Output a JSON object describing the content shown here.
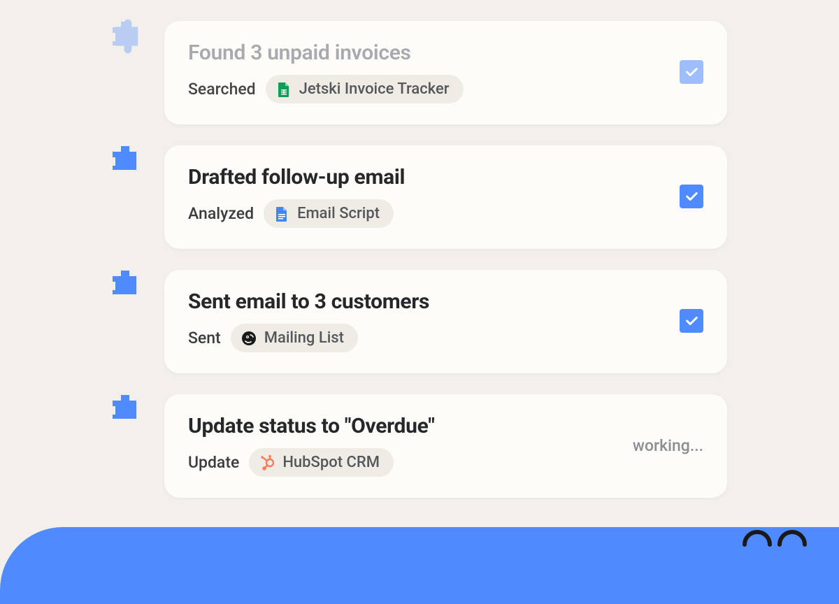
{
  "tasks": [
    {
      "title": "Found 3 unpaid invoices",
      "action": "Searched",
      "resource": "Jetski Invoice Tracker",
      "resource_icon": "sheets",
      "status": "done",
      "faded": true
    },
    {
      "title": "Drafted follow-up email",
      "action": "Analyzed",
      "resource": "Email Script",
      "resource_icon": "docs",
      "status": "done",
      "faded": false
    },
    {
      "title": "Sent email to 3 customers",
      "action": "Sent",
      "resource": "Mailing List",
      "resource_icon": "mailchimp",
      "status": "done",
      "faded": false
    },
    {
      "title": "Update status to \"Overdue\"",
      "action": "Update",
      "resource": "HubSpot CRM",
      "resource_icon": "hubspot",
      "status": "working",
      "faded": false
    }
  ],
  "working_label": "working..."
}
